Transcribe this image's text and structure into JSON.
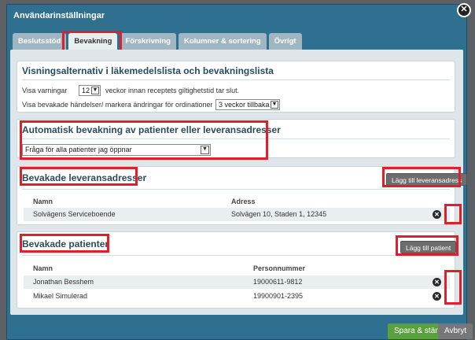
{
  "dialog": {
    "title": "Användarinställningar"
  },
  "tabs": [
    {
      "label": "Beslutsstöd"
    },
    {
      "label": "Bevakning"
    },
    {
      "label": "Förskrivning"
    },
    {
      "label": "Kolumner & sortering"
    },
    {
      "label": "Övrigt"
    }
  ],
  "display": {
    "heading": "Visningsalternativ i läkemedelslista och bevakningslista",
    "warn_prefix": "Visa varningar",
    "warn_value": "12",
    "warn_suffix": "veckor innan receptets giltighetstid tar slut.",
    "events_label": "Visa bevakade händelser/ markera ändringar för ordinationer",
    "events_value": "3 veckor tillbaka"
  },
  "auto": {
    "heading": "Automatisk bevakning av patienter eller leveransadresser",
    "value": "Fråga för alla patienter jag öppnar"
  },
  "addresses": {
    "heading": "Bevakade leveransadresser",
    "add_label": "Lägg till leveransadress",
    "col_name": "Namn",
    "col_address": "Adress",
    "rows": [
      {
        "name": "Solvägens Serviceboende",
        "address": "Solvägen 10, Staden 1, 12345"
      }
    ]
  },
  "patients": {
    "heading": "Bevakade patienter",
    "add_label": "Lägg till patient",
    "col_name": "Namn",
    "col_pnr": "Personnummer",
    "rows": [
      {
        "name": "Jonathan Besshem",
        "pnr": "19000611-9812"
      },
      {
        "name": "Mikael Simulerad",
        "pnr": "19900901-2395"
      }
    ]
  },
  "footer": {
    "save_label": "Spara & stäng",
    "cancel_label": "Avbryt"
  },
  "colors": {
    "accent_red": "#e01f2a",
    "save_green": "#5aa03c",
    "dialog_blue": "#2f6f8f"
  }
}
